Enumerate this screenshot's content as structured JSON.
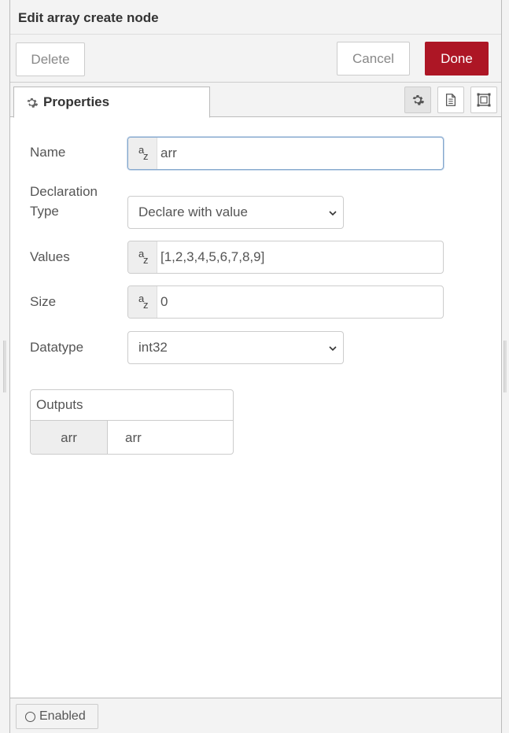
{
  "tray": {
    "title": "Edit array create node"
  },
  "toolbar": {
    "delete_label": "Delete",
    "cancel_label": "Cancel",
    "done_label": "Done"
  },
  "tabs": {
    "properties_label": "Properties",
    "icons": [
      "gear-icon",
      "description-icon",
      "appearance-icon"
    ]
  },
  "form": {
    "name": {
      "label": "Name",
      "type_icon": "string-type-icon",
      "value": "arr"
    },
    "declaration_type": {
      "label_line1": "Declaration",
      "label_line2": "Type",
      "value": "Declare with value"
    },
    "values": {
      "label": "Values",
      "type_icon": "string-type-icon",
      "value": "[1,2,3,4,5,6,7,8,9]"
    },
    "size": {
      "label": "Size",
      "type_icon": "string-type-icon",
      "value": "0"
    },
    "datatype": {
      "label": "Datatype",
      "value": "int32"
    }
  },
  "outputs": {
    "header": "Outputs",
    "rows": [
      {
        "key": "arr",
        "value": "arr"
      }
    ]
  },
  "footer": {
    "enabled_label": "Enabled"
  },
  "colors": {
    "done_button": "#ad1625",
    "focus_border": "#85a8cd"
  }
}
